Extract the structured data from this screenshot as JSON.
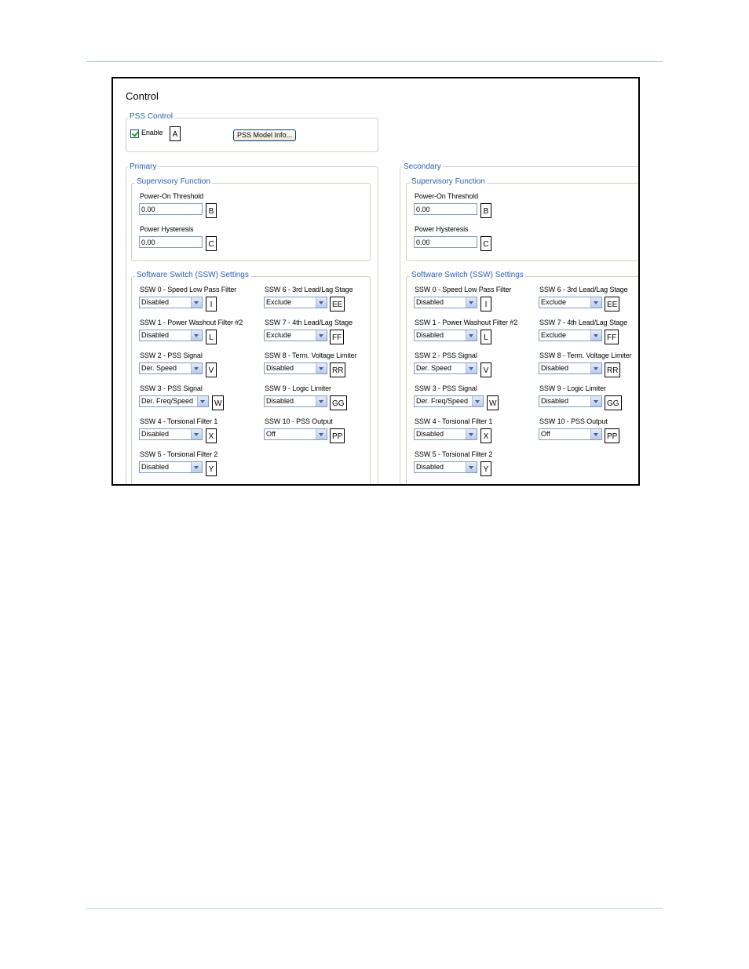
{
  "page": {
    "rule_color": "#b9ccd8"
  },
  "window": {
    "title": "Control",
    "pss_control": {
      "legend": "PSS Control",
      "enable_label": "Enable",
      "enable_checked": true,
      "enable_callout": "A",
      "model_button": "PSS Model Info..."
    },
    "primary": {
      "legend": "Primary",
      "supervisory": {
        "legend": "Supervisory Function",
        "power_on_label": "Power-On Threshold",
        "power_on_value": "0.00",
        "power_on_callout": "B",
        "hysteresis_label": "Power Hysteresis",
        "hysteresis_value": "0.00",
        "hysteresis_callout": "C"
      },
      "ssw": {
        "legend": "Software Switch (SSW) Settings",
        "ssw0": {
          "label": "SSW 0 - Speed Low Pass Filter",
          "value": "Disabled",
          "callout": "I"
        },
        "ssw1": {
          "label": "SSW 1 - Power Washout Filter #2",
          "value": "Disabled",
          "callout": "L"
        },
        "ssw2": {
          "label": "SSW 2 - PSS Signal",
          "value": "Der. Speed",
          "callout": "V"
        },
        "ssw3": {
          "label": "SSW 3 - PSS Signal",
          "value": "Der. Freq/Speed",
          "callout": "W"
        },
        "ssw4": {
          "label": "SSW 4 - Torsional Filter 1",
          "value": "Disabled",
          "callout": "X"
        },
        "ssw5": {
          "label": "SSW 5 - Torsional Filter 2",
          "value": "Disabled",
          "callout": "Y"
        },
        "ssw6": {
          "label": "SSW 6 - 3rd Lead/Lag Stage",
          "value": "Exclude",
          "callout": "EE"
        },
        "ssw7": {
          "label": "SSW 7 - 4th Lead/Lag Stage",
          "value": "Exclude",
          "callout": "FF"
        },
        "ssw8": {
          "label": "SSW 8 - Term. Voltage Limiter",
          "value": "Disabled",
          "callout": "RR"
        },
        "ssw9": {
          "label": "SSW 9 - Logic Limiter",
          "value": "Disabled",
          "callout": "GG"
        },
        "ssw10": {
          "label": "SSW 10 - PSS Output",
          "value": "Off",
          "callout": "PP"
        }
      }
    },
    "secondary": {
      "legend": "Secondary",
      "supervisory": {
        "legend": "Supervisory Function",
        "power_on_label": "Power-On Threshold",
        "power_on_value": "0.00",
        "power_on_callout": "B",
        "hysteresis_label": "Power Hysteresis",
        "hysteresis_value": "0.00",
        "hysteresis_callout": "C"
      },
      "ssw": {
        "legend": "Software Switch (SSW) Settings",
        "ssw0": {
          "label": "SSW 0 - Speed Low Pass Filter",
          "value": "Disabled",
          "callout": "I"
        },
        "ssw1": {
          "label": "SSW 1 - Power Washout Filter #2",
          "value": "Disabled",
          "callout": "L"
        },
        "ssw2": {
          "label": "SSW 2 - PSS Signal",
          "value": "Der. Speed",
          "callout": "V"
        },
        "ssw3": {
          "label": "SSW 3 - PSS Signal",
          "value": "Der. Freq/Speed",
          "callout": "W"
        },
        "ssw4": {
          "label": "SSW 4 - Torsional Filter 1",
          "value": "Disabled",
          "callout": "X"
        },
        "ssw5": {
          "label": "SSW 5 - Torsional Filter 2",
          "value": "Disabled",
          "callout": "Y"
        },
        "ssw6": {
          "label": "SSW 6 - 3rd Lead/Lag Stage",
          "value": "Exclude",
          "callout": "EE"
        },
        "ssw7": {
          "label": "SSW 7 - 4th Lead/Lag Stage",
          "value": "Exclude",
          "callout": "FF"
        },
        "ssw8": {
          "label": "SSW 8 - Term. Voltage Limiter",
          "value": "Disabled",
          "callout": "RR"
        },
        "ssw9": {
          "label": "SSW 9 - Logic Limiter",
          "value": "Disabled",
          "callout": "GG"
        },
        "ssw10": {
          "label": "SSW 10 - PSS Output",
          "value": "Off",
          "callout": "PP"
        }
      }
    }
  }
}
